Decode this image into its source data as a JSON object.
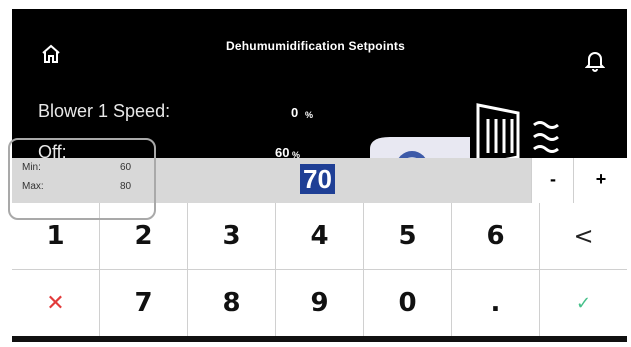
{
  "header": {
    "title": "Dehumumidification Setpoints"
  },
  "rows": [
    {
      "label": "Blower 1 Speed:",
      "value": "0",
      "unit": "%"
    },
    {
      "label": "Off:",
      "value": "60",
      "unit": "%"
    }
  ],
  "entry": {
    "value": "70",
    "minus_label": "-",
    "plus_label": "+"
  },
  "limits": {
    "min_label": "Min:",
    "min_value": "60",
    "max_label": "Max:",
    "max_value": "80"
  },
  "keypad": {
    "k1": "1",
    "k2": "2",
    "k3": "3",
    "k4": "4",
    "k5": "5",
    "k6": "6",
    "back": "<",
    "cancel": "✕",
    "k7": "7",
    "k8": "8",
    "k9": "9",
    "k0": "0",
    "dot": ".",
    "ok": "✓"
  },
  "colors": {
    "screen_bg": "#000000",
    "selection": "#1f3f95",
    "cancel": "#e23b3b",
    "ok": "#46c08a"
  },
  "icons": {
    "home": "home-icon",
    "bell": "bell-icon",
    "fan": "fan-icon",
    "dehumidifier": "dehumidifier-icon"
  }
}
